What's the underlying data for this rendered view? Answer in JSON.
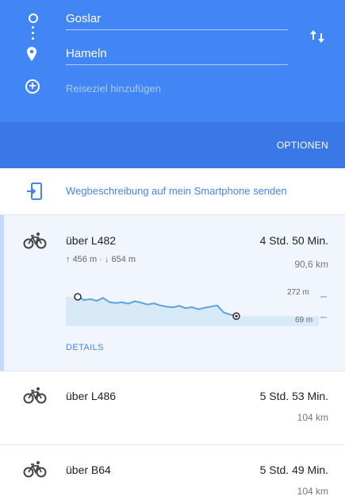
{
  "header": {
    "origin": "Goslar",
    "destination": "Hameln",
    "add_placeholder": "Reiseziel hinzufügen",
    "options_label": "OPTIONEN"
  },
  "send": {
    "label": "Wegbeschreibung auf mein Smartphone senden"
  },
  "routes": [
    {
      "name": "über L482",
      "time": "4 Std. 50 Min.",
      "distance": "90,6 km",
      "ascent": "456 m",
      "descent": "654 m",
      "elev_max": "272 m",
      "elev_min": "69 m",
      "details_label": "DETAILS"
    },
    {
      "name": "über L486",
      "time": "5 Std. 53 Min.",
      "distance": "104 km"
    },
    {
      "name": "über B64",
      "time": "5 Std. 49 Min.",
      "distance": "104 km"
    }
  ],
  "elevation_profile": [
    272,
    240,
    250,
    232,
    262,
    220,
    212,
    218,
    205,
    228,
    214,
    196,
    208,
    188,
    175,
    168,
    184,
    160,
    170,
    150,
    164,
    176,
    188,
    118,
    98,
    82
  ],
  "colors": {
    "primary": "#4285f4",
    "primary_dark": "#3b78e7",
    "profile_line": "#5aa2e0",
    "profile_fill": "#d8eaf8"
  }
}
